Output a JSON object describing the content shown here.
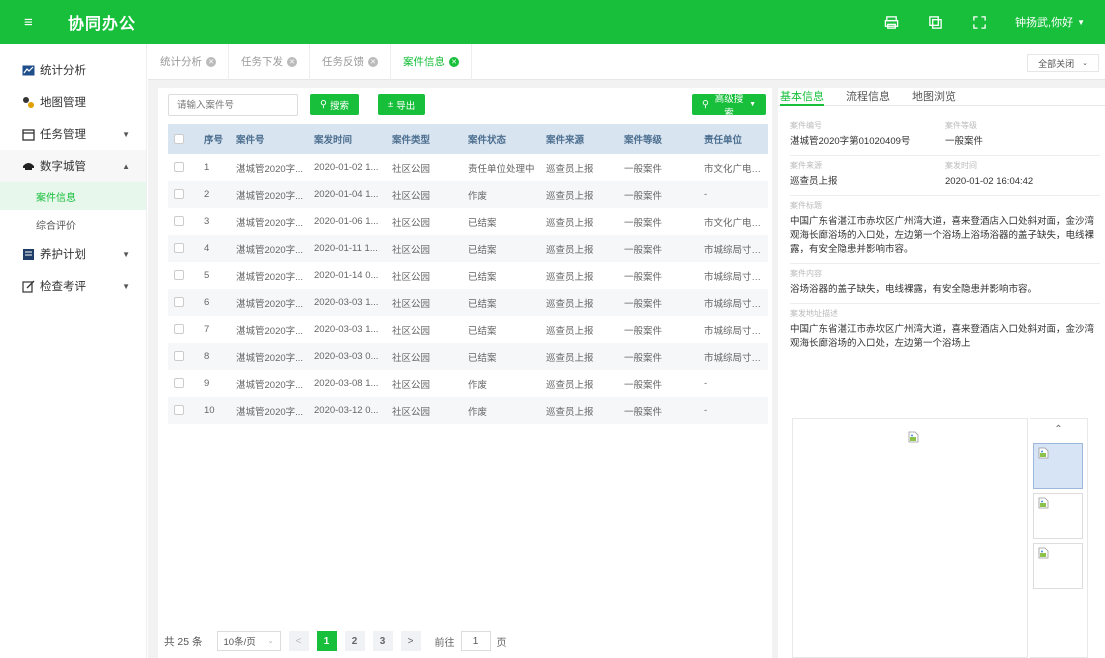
{
  "app": {
    "title": "协同办公"
  },
  "header": {
    "user": "钟扬武,你好"
  },
  "sidebar": {
    "items": [
      {
        "label": "统计分析",
        "icon": "chart-icon"
      },
      {
        "label": "地图管理",
        "icon": "map-icon"
      },
      {
        "label": "任务管理",
        "icon": "calendar-icon"
      },
      {
        "label": "数字城管",
        "icon": "police-cap-icon"
      },
      {
        "label": "养护计划",
        "icon": "plan-icon"
      },
      {
        "label": "检查考评",
        "icon": "edit-icon"
      }
    ],
    "sub_items": [
      {
        "label": "案件信息"
      },
      {
        "label": "综合评价"
      }
    ]
  },
  "tabs": [
    {
      "label": "统计分析"
    },
    {
      "label": "任务下发"
    },
    {
      "label": "任务反馈"
    },
    {
      "label": "案件信息"
    }
  ],
  "close_all": "全部关闭",
  "toolbar": {
    "search_placeholder": "请输入案件号",
    "search_label": "搜索",
    "export_label": "导出",
    "advanced_label": "高级搜索"
  },
  "table": {
    "headers": [
      "序号",
      "案件号",
      "案发时间",
      "案件类型",
      "案件状态",
      "案件来源",
      "案件等级",
      "责任单位"
    ],
    "rows": [
      [
        "1",
        "湛城管2020字...",
        "2020-01-02 1...",
        "社区公园",
        "责任单位处理中",
        "巡查员上报",
        "一般案件",
        "市文化广电旅..."
      ],
      [
        "2",
        "湛城管2020字...",
        "2020-01-04 1...",
        "社区公园",
        "作废",
        "巡查员上报",
        "一般案件",
        "-"
      ],
      [
        "3",
        "湛城管2020字...",
        "2020-01-06 1...",
        "社区公园",
        "已结案",
        "巡查员上报",
        "一般案件",
        "市文化广电旅..."
      ],
      [
        "4",
        "湛城管2020字...",
        "2020-01-11 1...",
        "社区公园",
        "已结案",
        "巡查员上报",
        "一般案件",
        "市城综局寸金..."
      ],
      [
        "5",
        "湛城管2020字...",
        "2020-01-14 0...",
        "社区公园",
        "已结案",
        "巡查员上报",
        "一般案件",
        "市城综局寸金..."
      ],
      [
        "6",
        "湛城管2020字...",
        "2020-03-03 1...",
        "社区公园",
        "已结案",
        "巡查员上报",
        "一般案件",
        "市城综局寸金..."
      ],
      [
        "7",
        "湛城管2020字...",
        "2020-03-03 1...",
        "社区公园",
        "已结案",
        "巡查员上报",
        "一般案件",
        "市城综局寸金..."
      ],
      [
        "8",
        "湛城管2020字...",
        "2020-03-03 0...",
        "社区公园",
        "已结案",
        "巡查员上报",
        "一般案件",
        "市城综局寸金..."
      ],
      [
        "9",
        "湛城管2020字...",
        "2020-03-08 1...",
        "社区公园",
        "作废",
        "巡查员上报",
        "一般案件",
        "-"
      ],
      [
        "10",
        "湛城管2020字...",
        "2020-03-12 0...",
        "社区公园",
        "作废",
        "巡查员上报",
        "一般案件",
        "-"
      ]
    ]
  },
  "pager": {
    "total": "共 25 条",
    "page_size": "10条/页",
    "pages": [
      "1",
      "2",
      "3"
    ],
    "goto_prefix": "前往",
    "goto_value": "1",
    "goto_suffix": "页"
  },
  "detail": {
    "tabs": [
      "基本信息",
      "流程信息",
      "地图浏览"
    ],
    "case_no_label": "案件编号",
    "case_no": "湛城管2020字第01020409号",
    "level_label": "案件等级",
    "level": "一般案件",
    "source_label": "案件来源",
    "source": "巡查员上报",
    "time_label": "案发时间",
    "time": "2020-01-02 16:04:42",
    "title_label": "案件标题",
    "title": "中国广东省湛江市赤坎区广州湾大道，喜来登酒店入口处斜对面，金沙湾观海长廊浴场的入口处，左边第一个浴场上浴场浴器的盖子缺失，电线裸露，有安全隐患并影响市容。",
    "content_label": "案件内容",
    "content": "浴场浴器的盖子缺失，电线裸露，有安全隐患并影响市容。",
    "address_label": "案发地址描述",
    "address": "中国广东省湛江市赤坎区广州湾大道，喜来登酒店入口处斜对面，金沙湾观海长廊浴场的入口处，左边第一个浴场上"
  }
}
